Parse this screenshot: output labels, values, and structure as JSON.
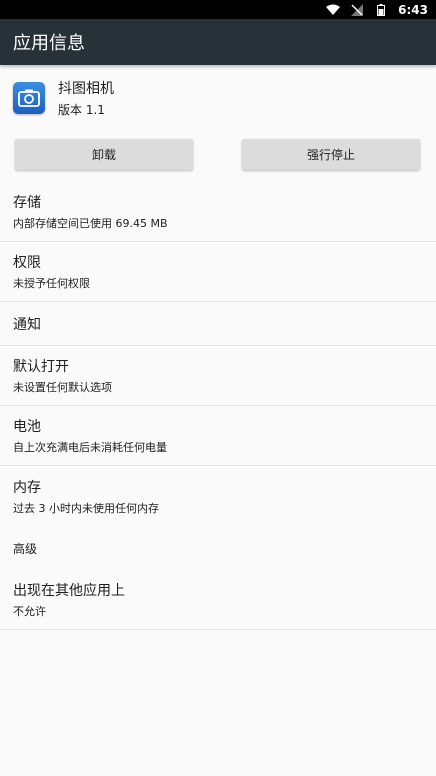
{
  "status_bar": {
    "time": "6:43"
  },
  "app_bar": {
    "title": "应用信息"
  },
  "app": {
    "name": "抖图相机",
    "version": "版本 1.1"
  },
  "buttons": {
    "uninstall": "卸载",
    "force_stop": "强行停止"
  },
  "rows": {
    "storage": {
      "title": "存储",
      "subtitle": "内部存储空间已使用 69.45 MB"
    },
    "permissions": {
      "title": "权限",
      "subtitle": "未授予任何权限"
    },
    "notifications": {
      "title": "通知"
    },
    "open_by_default": {
      "title": "默认打开",
      "subtitle": "未设置任何默认选项"
    },
    "battery": {
      "title": "电池",
      "subtitle": "自上次充满电后未消耗任何电量"
    },
    "memory": {
      "title": "内存",
      "subtitle": "过去 3 小时内未使用任何内存"
    },
    "advanced_label": "高级",
    "draw_over": {
      "title": "出现在其他应用上",
      "subtitle": "不允许"
    }
  },
  "colors": {
    "app_bar": "#263238",
    "status_bar": "#000000",
    "background": "#fafafa",
    "button": "#dcdcdc"
  }
}
